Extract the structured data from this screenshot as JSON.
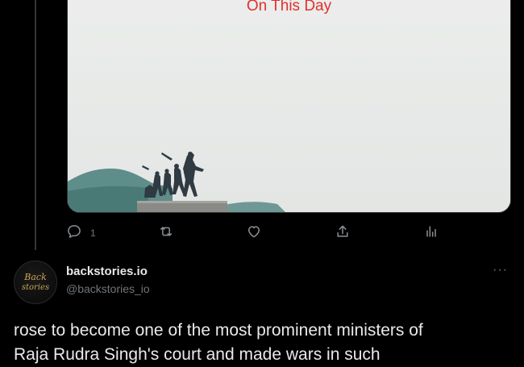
{
  "media": {
    "caption": "On This Day"
  },
  "actions": {
    "reply_count": "1",
    "retweet_count": "",
    "like_count": ""
  },
  "author": {
    "display_name": "backstories.io",
    "handle": "@backstories_io",
    "avatar_text": "Back stories"
  },
  "tweet": {
    "line1": "rose to become one of the most prominent ministers of",
    "line2": "Raja Rudra Singh's court and made wars in such"
  },
  "more_label": "···",
  "colors": {
    "background": "#000000",
    "caption": "#e0312b",
    "muted": "#71767b",
    "text": "#e7e9ea"
  },
  "icons": [
    "reply-icon",
    "retweet-icon",
    "like-icon",
    "share-icon",
    "analytics-icon",
    "more-icon"
  ]
}
